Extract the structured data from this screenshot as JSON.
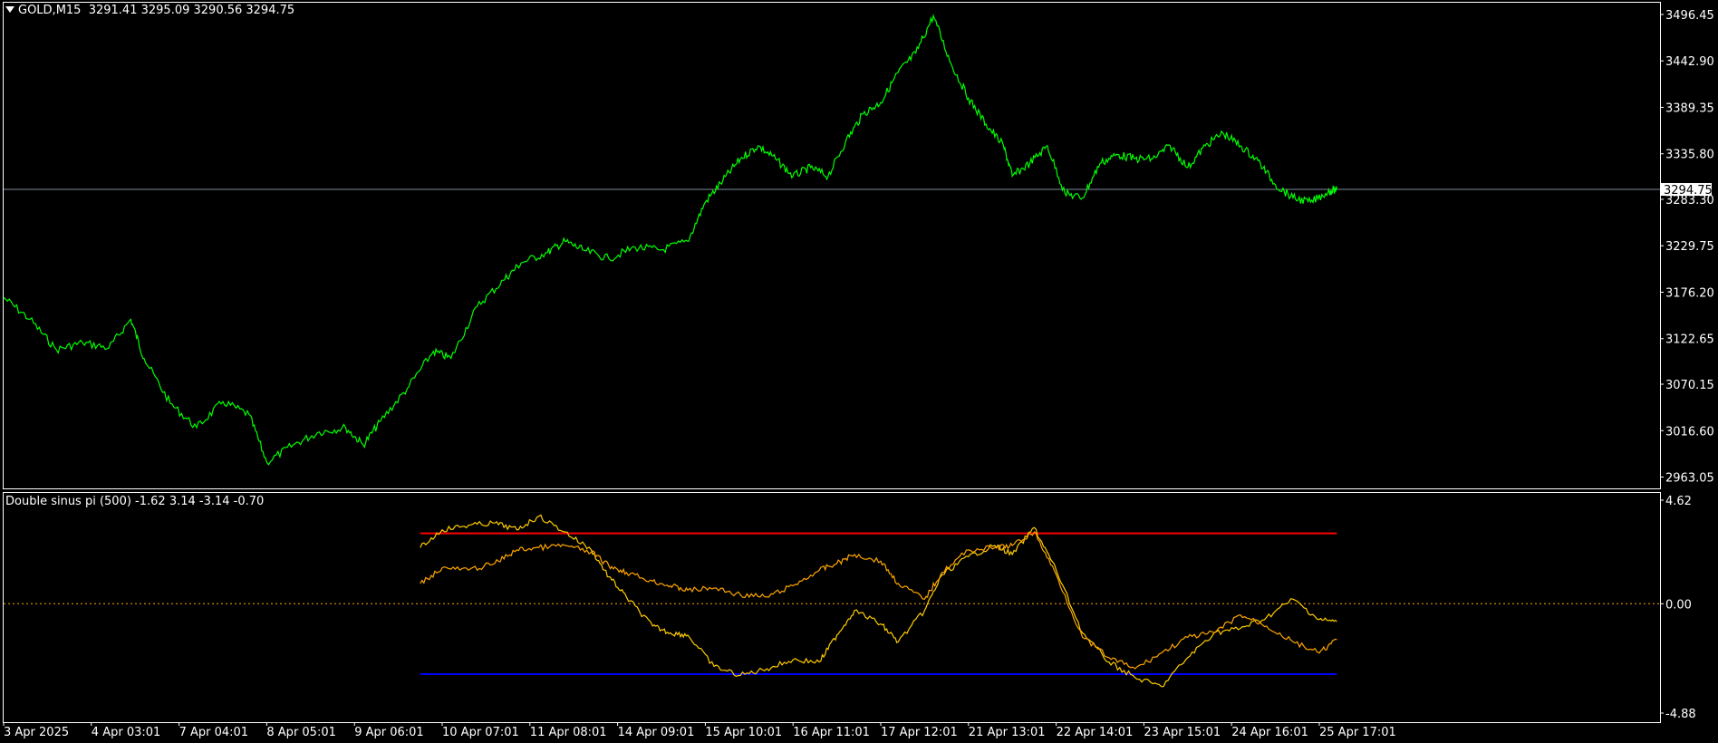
{
  "header": {
    "symbol": "GOLD,M15",
    "ohlc": "3291.41 3295.09 3290.56 3294.75"
  },
  "indicator": {
    "title": "Double sinus pi (500) -1.62 3.14 -3.14 -0.70"
  },
  "colors": {
    "background": "#000000",
    "price": "#00ff00",
    "osc_a": "#ffcc00",
    "osc_b": "#ffa500",
    "upper": "#ff0000",
    "lower": "#0000ff",
    "zero": "#ffa500",
    "frame": "#ffffff",
    "current_line": "#7f8c9a"
  },
  "chart_data": [
    {
      "type": "line",
      "title": "GOLD,M15",
      "current_price": 3294.75,
      "current_price_label": "3294.75",
      "ylim": [
        2950,
        3510
      ],
      "yticks": [
        "3496.45",
        "3442.90",
        "3389.35",
        "3335.80",
        "3283.30",
        "3229.75",
        "3176.20",
        "3122.65",
        "3070.15",
        "3016.60",
        "2963.05"
      ],
      "ytick_values": [
        3496.45,
        3442.9,
        3389.35,
        3335.8,
        3283.3,
        3229.75,
        3176.2,
        3122.65,
        3070.15,
        3016.6,
        2963.05
      ],
      "categories": [
        "3 Apr 2025",
        "4 Apr 03:01",
        "7 Apr 04:01",
        "8 Apr 05:01",
        "9 Apr 06:01",
        "10 Apr 07:01",
        "11 Apr 08:01",
        "14 Apr 09:01",
        "15 Apr 10:01",
        "16 Apr 11:01",
        "17 Apr 12:01",
        "21 Apr 13:01",
        "22 Apr 14:01",
        "23 Apr 15:01",
        "24 Apr 16:01",
        "25 Apr 17:01"
      ],
      "series": [
        {
          "x": [
            0,
            0.3,
            0.6,
            0.9,
            1.2,
            1.45,
            1.6,
            1.9,
            2.2,
            2.5,
            2.8,
            3.0,
            3.3,
            3.6,
            3.9,
            4.1,
            4.3,
            4.6,
            4.9,
            5.1,
            5.4,
            5.7,
            5.9,
            6.2,
            6.4,
            6.6,
            6.9,
            7.2,
            7.5,
            7.8,
            8.0,
            8.2,
            8.4,
            8.6,
            8.8,
            9.0,
            9.2,
            9.4,
            9.6,
            9.8,
            10.0,
            10.2,
            10.4,
            10.6,
            10.8,
            11.0,
            11.2,
            11.4,
            11.5,
            11.7,
            11.9,
            12.1,
            12.3,
            12.5,
            12.7,
            12.9,
            13.1,
            13.3,
            13.5,
            13.7,
            13.9,
            14.1,
            14.3,
            14.5,
            14.7,
            14.9,
            15.1,
            15.2
          ],
          "values": [
            3170,
            3145,
            3110,
            3118,
            3112,
            3145,
            3100,
            3048,
            3020,
            3050,
            3035,
            2980,
            3000,
            3015,
            3020,
            3000,
            3028,
            3065,
            3108,
            3100,
            3160,
            3190,
            3210,
            3222,
            3235,
            3225,
            3215,
            3228,
            3225,
            3235,
            3280,
            3305,
            3330,
            3345,
            3330,
            3310,
            3320,
            3310,
            3350,
            3382,
            3395,
            3430,
            3452,
            3495,
            3440,
            3400,
            3370,
            3345,
            3310,
            3325,
            3345,
            3290,
            3285,
            3325,
            3335,
            3330,
            3330,
            3345,
            3320,
            3345,
            3360,
            3345,
            3328,
            3300,
            3285,
            3280,
            3292,
            3294.75
          ]
        }
      ]
    },
    {
      "type": "line",
      "title": "Double sinus pi (500)",
      "ylim": [
        -4.88,
        4.62
      ],
      "yticks": [
        "4.62",
        "0.00",
        "-4.88"
      ],
      "levels": [
        3.14,
        0.0,
        -3.14
      ],
      "series": [
        {
          "x": [
            4.75,
            5.0,
            5.3,
            5.6,
            5.85,
            6.1,
            6.4,
            6.7,
            6.9,
            7.1,
            7.4,
            7.6,
            7.8,
            8.1,
            8.4,
            8.7,
            9.0,
            9.3,
            9.5,
            9.7,
            10.0,
            10.2,
            10.5,
            10.7,
            11.0,
            11.3,
            11.5,
            11.75,
            12.0,
            12.3,
            12.6,
            12.9,
            13.2,
            13.5,
            13.8,
            14.1,
            14.4,
            14.7,
            15.0,
            15.2
          ],
          "values": [
            2.5,
            3.3,
            3.5,
            3.6,
            3.3,
            3.9,
            3.2,
            2.4,
            1.2,
            0.3,
            -1.0,
            -1.3,
            -1.4,
            -2.8,
            -3.2,
            -2.9,
            -2.5,
            -2.6,
            -1.4,
            -0.3,
            -0.9,
            -1.7,
            -0.3,
            1.3,
            2.1,
            2.6,
            2.2,
            3.4,
            1.5,
            -1.3,
            -2.6,
            -3.3,
            -3.7,
            -2.4,
            -1.3,
            -1.1,
            -0.6,
            0.2,
            -0.7,
            -0.8
          ]
        },
        {
          "x": [
            4.75,
            5.0,
            5.3,
            5.6,
            5.85,
            6.1,
            6.4,
            6.7,
            6.9,
            7.1,
            7.4,
            7.6,
            7.8,
            8.1,
            8.4,
            8.7,
            9.0,
            9.3,
            9.5,
            9.7,
            10.0,
            10.2,
            10.5,
            10.7,
            11.0,
            11.3,
            11.5,
            11.75,
            12.0,
            12.3,
            12.6,
            12.9,
            13.2,
            13.5,
            13.8,
            14.1,
            14.4,
            14.7,
            15.0,
            15.2
          ],
          "values": [
            0.9,
            1.6,
            1.5,
            1.8,
            2.4,
            2.5,
            2.6,
            2.3,
            1.7,
            1.4,
            1.0,
            0.8,
            0.6,
            0.7,
            0.4,
            0.3,
            0.8,
            1.5,
            1.8,
            2.2,
            1.9,
            0.9,
            0.2,
            1.4,
            2.4,
            2.5,
            2.6,
            3.2,
            1.3,
            -1.5,
            -2.4,
            -2.9,
            -2.2,
            -1.5,
            -1.3,
            -0.5,
            -1.0,
            -1.7,
            -2.2,
            -1.6
          ]
        }
      ]
    }
  ]
}
